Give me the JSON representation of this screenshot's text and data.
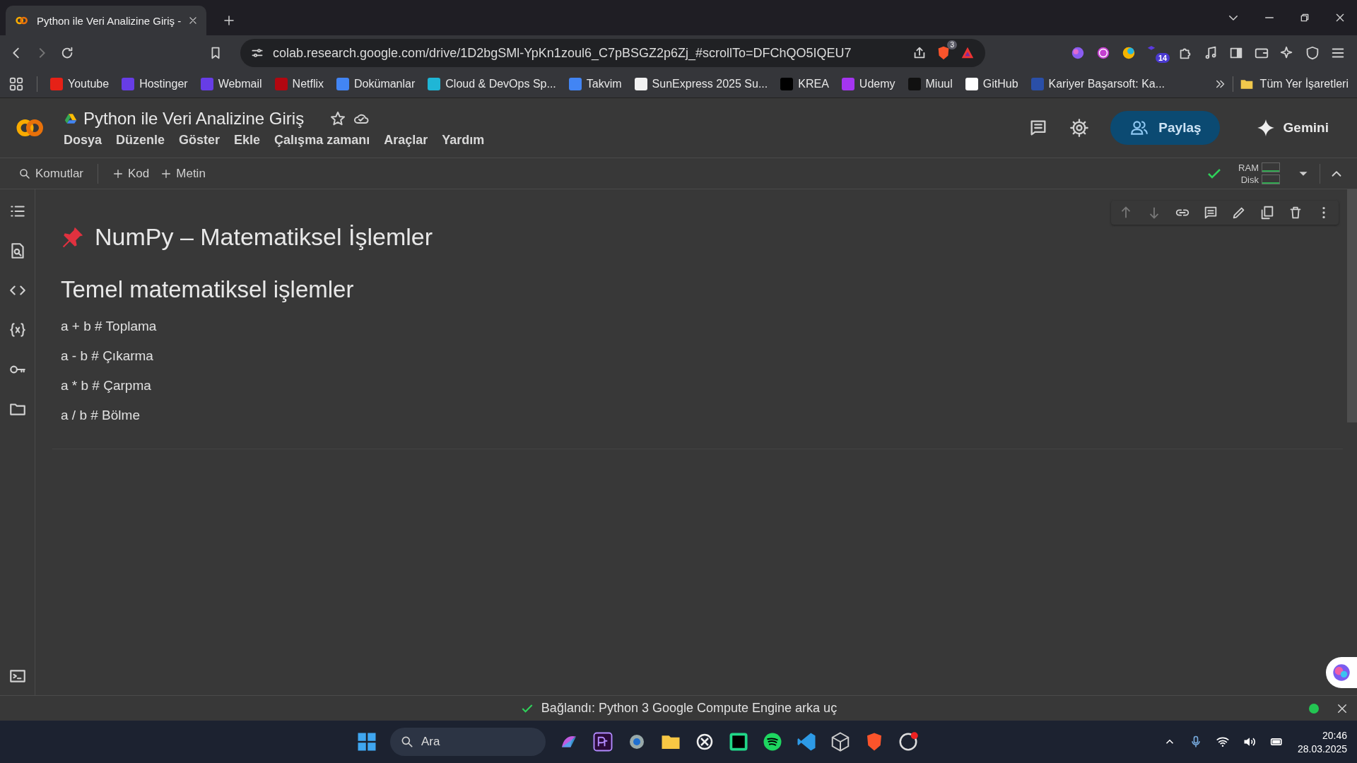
{
  "browser": {
    "tab": {
      "title": "Python ile Veri Analizine Giriş -",
      "selected": true
    },
    "url": "colab.research.google.com/drive/1D2bgSMl-YpKn1zoul6_C7pBSGZ2p6Zj_#scrollTo=DFChQO5IQEU7",
    "shield_badge": "3",
    "extension_badge": "14",
    "bookmarks": [
      {
        "label": "Youtube",
        "color": "#e62117"
      },
      {
        "label": "Hostinger",
        "color": "#673de6"
      },
      {
        "label": "Webmail",
        "color": "#673de6"
      },
      {
        "label": "Netflix",
        "color": "#b20710"
      },
      {
        "label": "Dokümanlar",
        "color": "#4285f4"
      },
      {
        "label": "Cloud & DevOps Sp...",
        "color": "#1fb6d6"
      },
      {
        "label": "Takvim",
        "color": "#4285f4"
      },
      {
        "label": "SunExpress 2025 Su...",
        "color": "#f2f2f2"
      },
      {
        "label": "KREA",
        "color": "#000000"
      },
      {
        "label": "Udemy",
        "color": "#a435f0"
      },
      {
        "label": "Miuul",
        "color": "#111111"
      },
      {
        "label": "GitHub",
        "color": "#ffffff"
      },
      {
        "label": "Kariyer Başarsoft: Ka...",
        "color": "#2a4fa8"
      }
    ],
    "all_bookmarks": "Tüm Yer İşaretleri"
  },
  "colab": {
    "title": "Python ile Veri Analizine Giriş",
    "menu": [
      "Dosya",
      "Düzenle",
      "Göster",
      "Ekle",
      "Çalışma zamanı",
      "Araçlar",
      "Yardım"
    ],
    "share": "Paylaş",
    "gemini": "Gemini",
    "toolbar": {
      "commands": "Komutlar",
      "add_code": "Kod",
      "add_text": "Metin"
    },
    "resources": [
      {
        "label": "RAM"
      },
      {
        "label": "Disk"
      }
    ]
  },
  "cell": {
    "title": "NumPy – Matematiksel İşlemler",
    "subtitle": "Temel matematiksel işlemler",
    "lines": [
      "a + b # Toplama",
      "a - b # Çıkarma",
      "a * b # Çarpma",
      "a / b # Bölme"
    ]
  },
  "status_bar": {
    "text": "Bağlandı: Python 3 Google Compute Engine arka uç"
  },
  "taskbar": {
    "search": "Ara",
    "time": "20:46",
    "date": "28.03.2025"
  }
}
